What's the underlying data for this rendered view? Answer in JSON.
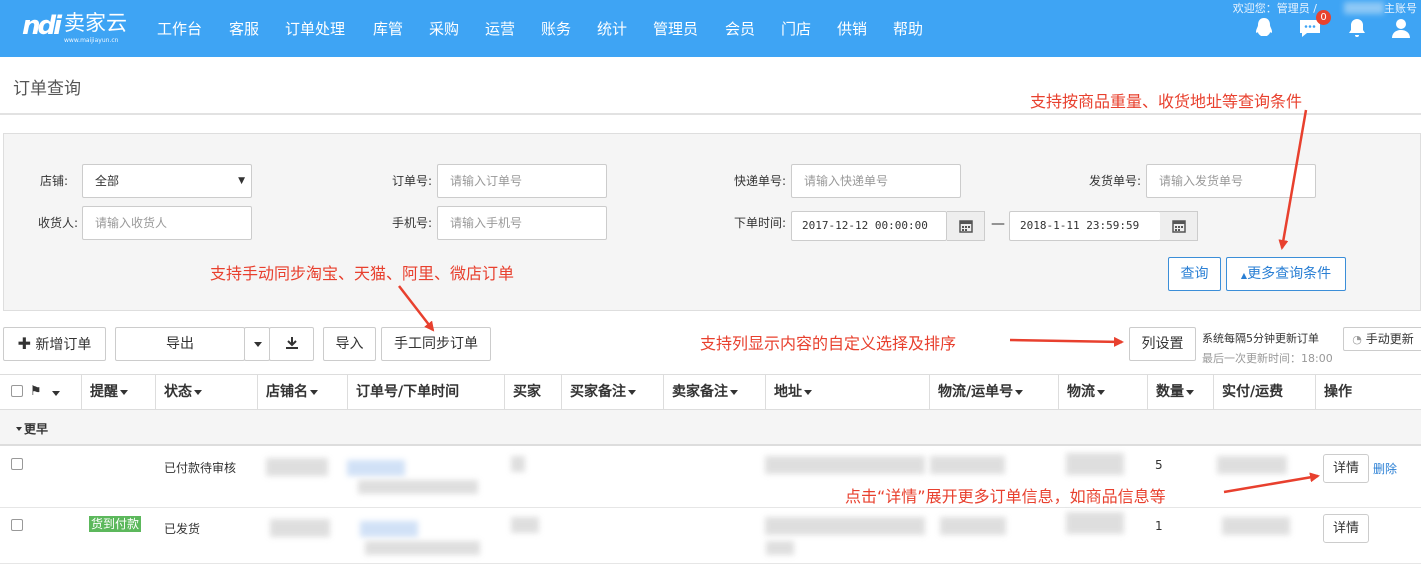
{
  "brand": {
    "mark": "ndi",
    "name": "卖家云",
    "sub": "www.maijiayun.cn"
  },
  "nav": [
    "工作台",
    "客服",
    "订单处理",
    "库管",
    "采购",
    "运营",
    "账务",
    "统计",
    "管理员",
    "会员",
    "门店",
    "供销",
    "帮助"
  ],
  "header": {
    "welcome": "欢迎您：管理员 /",
    "account_suffix": "主账号",
    "msg_badge": "0"
  },
  "page": {
    "title": "订单查询"
  },
  "annotations": {
    "more_filters": "支持按商品重量、收货地址等查询条件",
    "sync": "支持手动同步淘宝、天猫、阿里、微店订单",
    "columns": "支持列显示内容的自定义选择及排序",
    "details": "点击“详情”展开更多订单信息，如商品信息等"
  },
  "filters": {
    "shop": {
      "label": "店铺:",
      "value": "全部"
    },
    "order_no": {
      "label": "订单号:",
      "placeholder": "请输入订单号"
    },
    "express_no": {
      "label": "快递单号:",
      "placeholder": "请输入快递单号"
    },
    "ship_no": {
      "label": "发货单号:",
      "placeholder": "请输入发货单号"
    },
    "receiver": {
      "label": "收货人:",
      "placeholder": "请输入收货人"
    },
    "phone": {
      "label": "手机号:",
      "placeholder": "请输入手机号"
    },
    "order_time": {
      "label": "下单时间:",
      "start": "2017-12-12 00:00:00",
      "end": "2018-1-11 23:59:59",
      "separator": "—"
    },
    "query_button": "查询",
    "more_button": "更多查询条件"
  },
  "toolbar": {
    "new_order": "新增订单",
    "export": "导出",
    "import": "导入",
    "manual_sync": "手工同步订单",
    "column_settings": "列设置",
    "auto_update_note": "系统每隔5分钟更新订单",
    "last_update": "最后一次更新时间：18:00",
    "manual_update": "手动更新"
  },
  "table": {
    "columns": [
      "提醒",
      "状态",
      "店铺名",
      "订单号/下单时间",
      "买家",
      "买家备注",
      "卖家备注",
      "地址",
      "物流/运单号",
      "物流",
      "数量",
      "实付/运费",
      "操作"
    ],
    "group_label": "更早",
    "rows": [
      {
        "status": "已付款待审核",
        "quantity": "5",
        "detail": "详情",
        "delete": "删除",
        "tag": ""
      },
      {
        "status": "已发货",
        "quantity": "1",
        "detail": "详情",
        "delete": "",
        "tag": "货到付款"
      }
    ]
  },
  "colors": {
    "nav_bg": "#3ea4f4",
    "annotation": "#e8402e",
    "link": "#2a7fd4",
    "cod_tag": "#5cb85c",
    "badge": "#e8432e"
  }
}
